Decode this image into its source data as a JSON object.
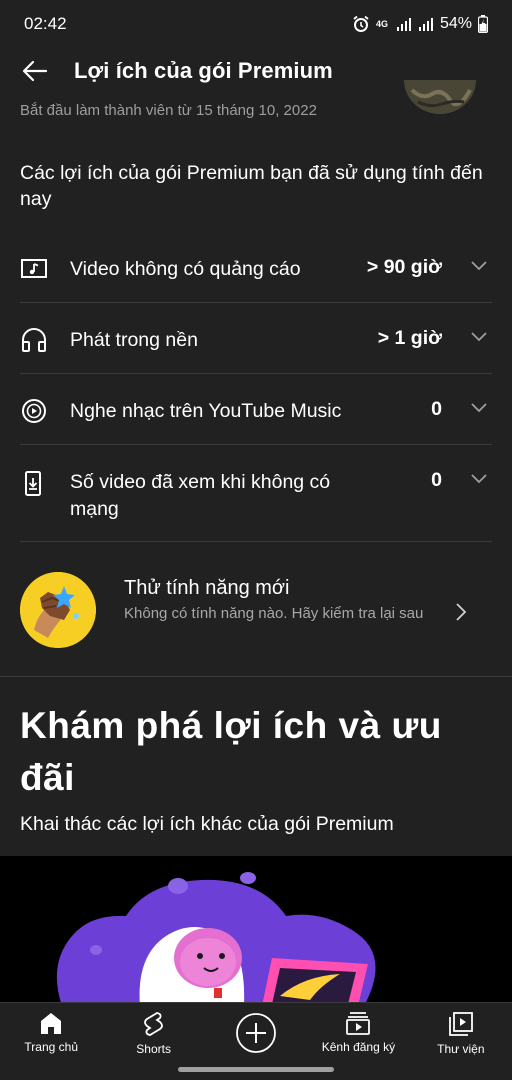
{
  "status_bar": {
    "time": "02:42",
    "network_label": "4G",
    "battery": "54%"
  },
  "app_bar": {
    "title": "Lợi ích của gói Premium"
  },
  "member_since": "Bắt đầu làm thành viên từ 15 tháng 10, 2022",
  "benefits_section": {
    "heading": "Các lợi ích của gói Premium bạn đã sử dụng tính đến nay",
    "items": [
      {
        "icon": "ad-free-music-icon",
        "label": "Video không có quảng cáo",
        "value": "> 90 giờ"
      },
      {
        "icon": "headphones-icon",
        "label": "Phát trong nền",
        "value": "> 1 giờ"
      },
      {
        "icon": "youtube-music-icon",
        "label": "Nghe nhạc trên YouTube Music",
        "value": "0"
      },
      {
        "icon": "offline-download-icon",
        "label": "Số video đã xem khi không có mạng",
        "value": "0"
      }
    ]
  },
  "new_features": {
    "title": "Thử tính năng mới",
    "subtitle": "Không có tính năng nào. Hãy kiểm tra lại sau"
  },
  "explore": {
    "title": "Khám phá lợi ích và ưu đãi",
    "subtitle": "Khai thác các lợi ích khác của gói Premium"
  },
  "bottom_nav": {
    "items": [
      {
        "icon": "home-icon",
        "label": "Trang chủ"
      },
      {
        "icon": "shorts-icon",
        "label": "Shorts"
      },
      {
        "icon": "create-plus-icon",
        "label": ""
      },
      {
        "icon": "subscriptions-icon",
        "label": "Kênh đăng ký"
      },
      {
        "icon": "library-icon",
        "label": "Thư viện"
      }
    ]
  },
  "colors": {
    "background": "#212121",
    "divider": "#3b3b3b",
    "secondary_text": "#9e9e9e",
    "badge_yellow": "#f7cf24",
    "promo_purple": "#6c3fd6"
  }
}
